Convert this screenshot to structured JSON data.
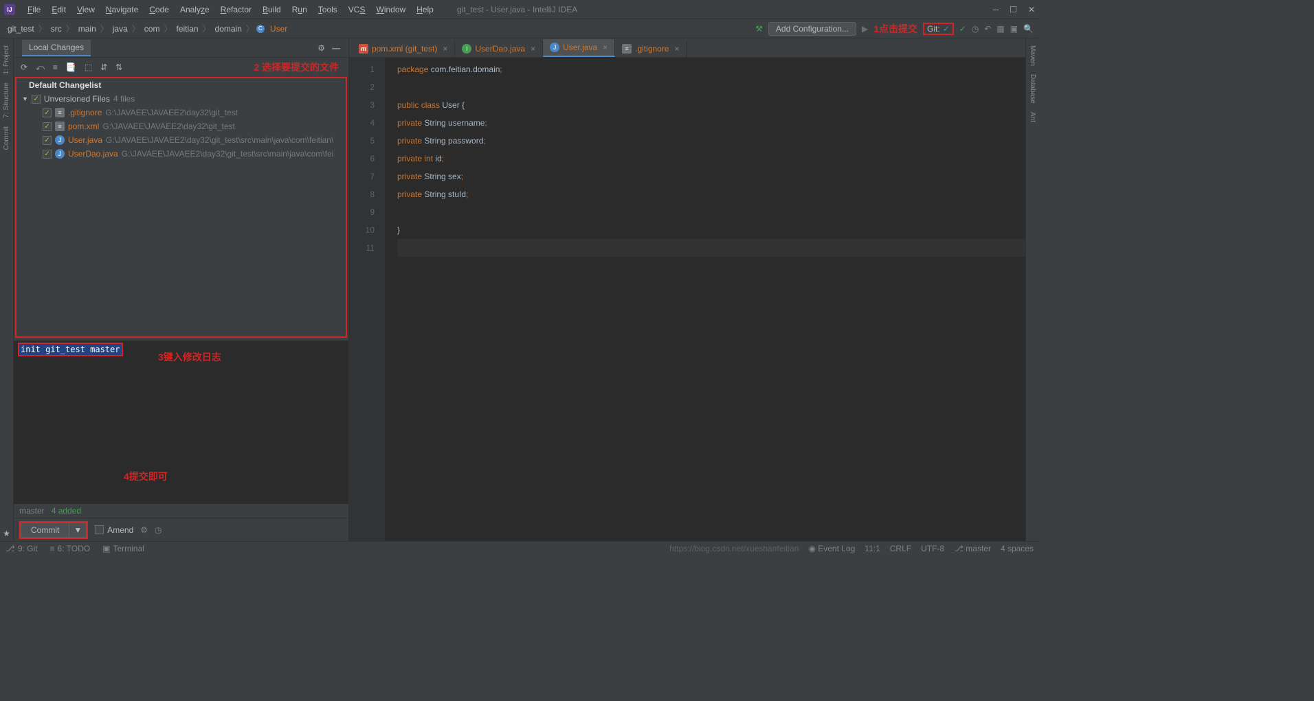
{
  "menu": {
    "items": [
      "File",
      "Edit",
      "View",
      "Navigate",
      "Code",
      "Analyze",
      "Refactor",
      "Build",
      "Run",
      "Tools",
      "VCS",
      "Window",
      "Help"
    ],
    "title": "git_test - User.java - IntelliJ IDEA"
  },
  "breadcrumb": [
    "git_test",
    "src",
    "main",
    "java",
    "com",
    "feitian",
    "domain",
    "User"
  ],
  "nav": {
    "config": "Add Configuration...",
    "ann1": "1点击提交",
    "git": "Git:"
  },
  "leftbar": [
    "1: Project",
    "7: Structure",
    "Commit"
  ],
  "rightbar": [
    "Maven",
    "Database",
    "Ant"
  ],
  "commit": {
    "tab": "Local Changes",
    "ann2": "2 选择要提交的文件",
    "default": "Default Changelist",
    "unversioned": "Unversioned Files",
    "count": "4 files",
    "files": [
      {
        "name": ".gitignore",
        "path": "G:\\JAVAEE\\JAVAEE2\\day32\\git_test",
        "icon": "txt"
      },
      {
        "name": "pom.xml",
        "path": "G:\\JAVAEE\\JAVAEE2\\day32\\git_test",
        "icon": "txt"
      },
      {
        "name": "User.java",
        "path": "G:\\JAVAEE\\JAVAEE2\\day32\\git_test\\src\\main\\java\\com\\feitian\\",
        "icon": "java"
      },
      {
        "name": "UserDao.java",
        "path": "G:\\JAVAEE\\JAVAEE2\\day32\\git_test\\src\\main\\java\\com\\fei",
        "icon": "java"
      }
    ],
    "msg": "init git_test master",
    "ann3": "3键入修改日志",
    "ann4": "4提交即可",
    "branch": "master",
    "added": "4 added",
    "button": "Commit",
    "amend": "Amend"
  },
  "tabs": [
    {
      "name": "pom.xml (git_test)",
      "icon": "m",
      "red": true,
      "active": false
    },
    {
      "name": "UserDao.java",
      "icon": "i",
      "red": true,
      "active": false
    },
    {
      "name": "User.java",
      "icon": "j",
      "red": true,
      "active": true
    },
    {
      "name": ".gitignore",
      "icon": "g",
      "red": true,
      "active": false
    }
  ],
  "code": {
    "lines": [
      {
        "n": 1,
        "t": [
          [
            "kw",
            "package "
          ],
          [
            "pln",
            "com.feitian.domain"
          ],
          [
            "pun",
            ";"
          ]
        ]
      },
      {
        "n": 2,
        "t": []
      },
      {
        "n": 3,
        "t": [
          [
            "kw",
            "public class "
          ],
          [
            "typ",
            "User "
          ],
          [
            "pln",
            "{"
          ]
        ]
      },
      {
        "n": 4,
        "t": [
          [
            "pln",
            "    "
          ],
          [
            "kw",
            "private "
          ],
          [
            "typ",
            "String "
          ],
          [
            "pln",
            "username"
          ],
          [
            "pun",
            ";"
          ]
        ]
      },
      {
        "n": 5,
        "t": [
          [
            "pln",
            "    "
          ],
          [
            "kw",
            "private "
          ],
          [
            "typ",
            "String "
          ],
          [
            "pln",
            "password"
          ],
          [
            "pun",
            ";"
          ]
        ]
      },
      {
        "n": 6,
        "t": [
          [
            "pln",
            "    "
          ],
          [
            "kw",
            "private  int   "
          ],
          [
            "pln",
            "id"
          ],
          [
            "pun",
            ";"
          ]
        ]
      },
      {
        "n": 7,
        "t": [
          [
            "pln",
            "    "
          ],
          [
            "kw",
            "private "
          ],
          [
            "typ",
            "String  "
          ],
          [
            "pln",
            "sex"
          ],
          [
            "pun",
            ";"
          ]
        ]
      },
      {
        "n": 8,
        "t": [
          [
            "pln",
            "    "
          ],
          [
            "kw",
            "private "
          ],
          [
            "typ",
            "String "
          ],
          [
            "pln",
            "stuId"
          ],
          [
            "pun",
            ";"
          ]
        ]
      },
      {
        "n": 9,
        "t": []
      },
      {
        "n": 10,
        "t": [
          [
            "pln",
            "}"
          ]
        ]
      },
      {
        "n": 11,
        "t": [],
        "cur": true
      }
    ]
  },
  "status": {
    "git": "9: Git",
    "todo": "6: TODO",
    "terminal": "Terminal",
    "url": "https://blog.csdn.net/xueshanfeitian",
    "eventlog": "Event Log",
    "pos": "11:1",
    "crlf": "CRLF",
    "enc": "UTF-8",
    "branch": "master",
    "indent": "4 spaces"
  }
}
